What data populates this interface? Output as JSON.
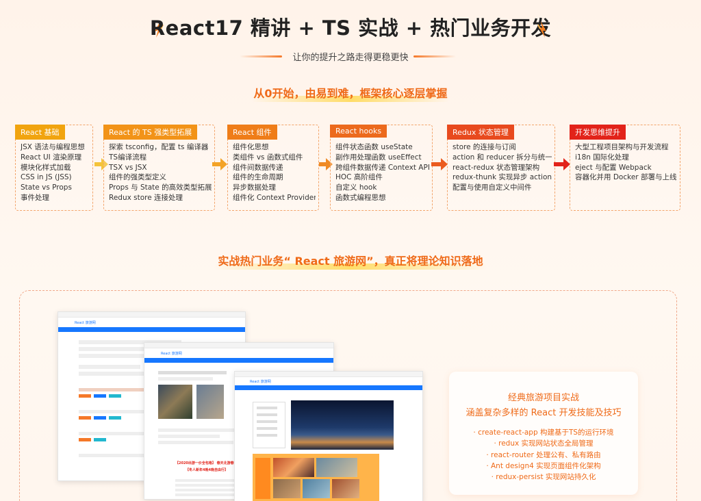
{
  "header": {
    "title": "React17 精讲 + TS 实战 + 热门业务开发",
    "subtitle": "让你的提升之路走得更稳更快"
  },
  "roadmap": {
    "heading": "从0开始，由易到难，框架核心逐层掌握",
    "stages": [
      {
        "tag": "React 基础",
        "color": "#f1a40f",
        "items": [
          "JSX 语法与编程思想",
          "React UI 渲染原理",
          "模块化样式加载",
          "CSS in JS (JSS)",
          "State vs Props",
          "事件处理"
        ]
      },
      {
        "tag": "React 的 TS 强类型拓展",
        "color": "#f29318",
        "items": [
          "探索 tsconfig，配置 ts 编译器",
          "TS编译流程",
          "TSX vs JSX",
          "组件的强类型定义",
          "Props 与 State 的高效类型拓展",
          "Redux store 连接处理"
        ]
      },
      {
        "tag": "React 组件",
        "color": "#ef7d19",
        "items": [
          "组件化思想",
          "类组件 vs 函数式组件",
          "组件间数据传递",
          "组件的生命周期",
          "异步数据处理",
          "组件化 Context Provider"
        ]
      },
      {
        "tag": "React hooks",
        "color": "#ec6a1d",
        "items": [
          "组件状态函数 useState",
          "副作用处理函数 useEffect",
          "跨组件数据传递 Context API",
          "HOC 高阶组件",
          "自定义 hook",
          "函数式编程思想"
        ]
      },
      {
        "tag": "Redux 状态管理",
        "color": "#e84a1e",
        "items": [
          "store 的连接与订阅",
          "action 和 reducer 拆分与统一",
          "react-redux 状态管理架构",
          "redux-thunk 实现异步 action",
          "配置与使用自定义中间件"
        ]
      },
      {
        "tag": "开发思维提升",
        "color": "#e2231a",
        "items": [
          "大型工程项目架构与开发流程",
          "i18n 国际化处理",
          "eject 与配置 Webpack",
          "容器化并用 Docker 部署与上线"
        ]
      }
    ]
  },
  "project": {
    "heading": "实战热门业务“ React 旅游网”，真正将理论知识落地",
    "card": {
      "title": "经典旅游项目实战",
      "subtitle": "涵盖复杂多样的 React 开发技能及技巧",
      "items": [
        "· create-react-app 构建基于TS的运行环境",
        "· redux 实现网站状态全局管理",
        "· react-router 处理公有、私有路由",
        "· Ant design4 实现页面组件化架构",
        "· redux-persist 实现网站持久化"
      ]
    },
    "screenshots": {
      "site_name": "React 旅游网",
      "promo_text": "【2020出游一价全包格】 春天北游春节",
      "promo_text2": "【冬人新年4晚4晚自由行】"
    }
  },
  "colors": {
    "accent": "#ef6a18",
    "background": "#fff6ee",
    "nav": "#1677ff"
  }
}
